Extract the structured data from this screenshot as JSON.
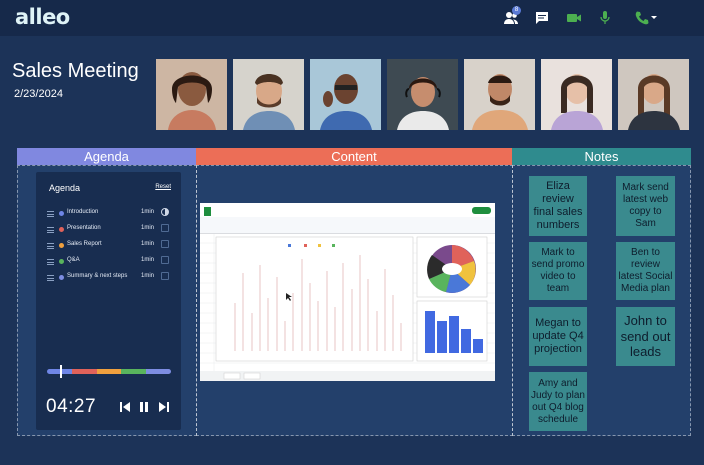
{
  "app": {
    "logo": "alleo"
  },
  "topbar": {
    "participants_count": "8"
  },
  "meeting": {
    "title": "Sales Meeting",
    "date": "2/23/2024"
  },
  "participants": [
    "participant-1",
    "participant-2",
    "participant-3",
    "participant-4",
    "participant-5",
    "participant-6",
    "participant-7"
  ],
  "sections": {
    "agenda": "Agenda",
    "content": "Content",
    "notes": "Notes"
  },
  "agenda": {
    "title": "Agenda",
    "reset_label": "Reset",
    "items": [
      {
        "label": "Introduction",
        "duration": "1min",
        "color": "#6f86e6"
      },
      {
        "label": "Presentation",
        "duration": "1min",
        "color": "#e0625a"
      },
      {
        "label": "Sales Report",
        "duration": "1min",
        "color": "#f0a03e"
      },
      {
        "label": "Q&A",
        "duration": "1min",
        "color": "#59b45d"
      },
      {
        "label": "Summary & next steps",
        "duration": "1min",
        "color": "#7d8de2"
      }
    ],
    "timer": "04:27"
  },
  "spreadsheet": {
    "title": "Product Orders",
    "menu": "File  Edit  View  Insert  Format  Data  Tools  Extensions  Help",
    "share_label": "Share",
    "tabs": [
      "Sheet1",
      "Chart1"
    ]
  },
  "notes": {
    "left": [
      "Eliza review final sales numbers",
      "Mark to send promo video to team",
      "Megan to update Q4 projection",
      "Amy and Judy to plan out Q4 blog schedule"
    ],
    "right": [
      "Mark send latest web copy to Sam",
      "Ben to review latest Social Media plan",
      "John to send out leads"
    ]
  },
  "colors": {
    "accent_agenda": "#8088e0",
    "accent_content": "#ec6e57",
    "accent_notes": "#2f8b8e",
    "note_bg": "#3a8a8e"
  }
}
